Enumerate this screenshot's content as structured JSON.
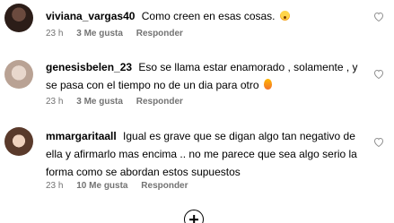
{
  "comments": [
    {
      "username": "viviana_vargas40",
      "text": "Como creen en esas cosas.",
      "emoji": "shocked-face-emoji",
      "time": "23 h",
      "likes": "3 Me gusta",
      "reply": "Responder"
    },
    {
      "username": "genesisbelen_23",
      "text": "Eso se llama estar enamorado , solamente , y se pasa con el tiempo no de un dia para otro",
      "emoji": "fire-emoji",
      "time": "23 h",
      "likes": "3 Me gusta",
      "reply": "Responder"
    },
    {
      "username": "mmargaritaall",
      "text": "Igual es grave que se digan algo tan negativo de ella y afirmarlo mas encima .. no me parece que sea algo serio la forma como se abordan estos supuestos",
      "time": "23 h",
      "likes": "10 Me gusta",
      "reply": "Responder"
    }
  ],
  "icons": {
    "like": "heart-icon",
    "load_more": "plus-circle-icon"
  }
}
